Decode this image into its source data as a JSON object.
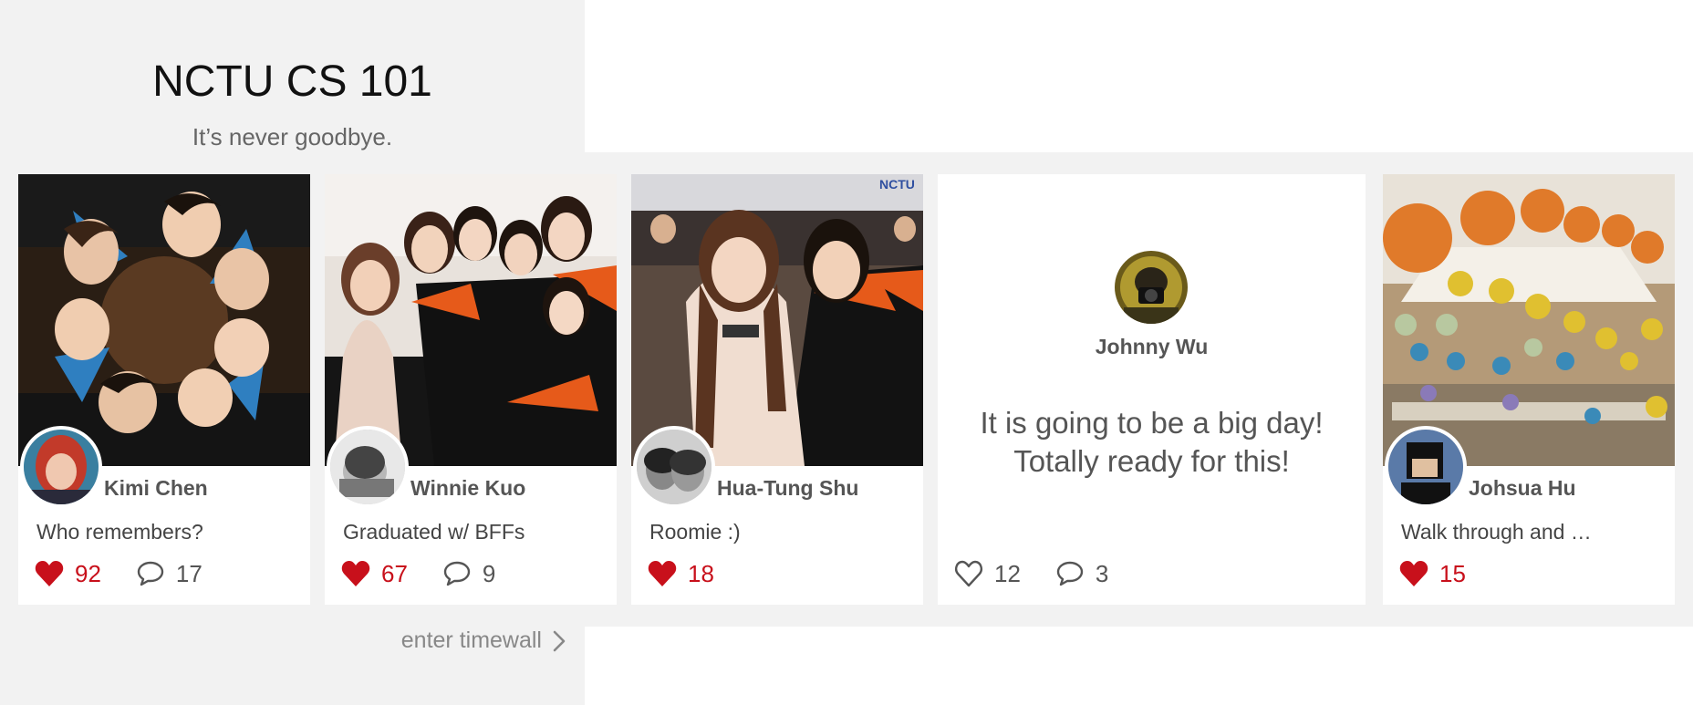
{
  "header": {
    "title": "NCTU CS 101",
    "subtitle": "It’s never goodbye."
  },
  "cards": [
    {
      "author": "Kimi Chen",
      "caption": "Who remembers?",
      "likes": "92",
      "comments": "17",
      "liked": true
    },
    {
      "author": "Winnie Kuo",
      "caption": "Graduated w/ BFFs",
      "likes": "67",
      "comments": "9",
      "liked": true
    },
    {
      "author": "Hua-Tung Shu",
      "caption": "Roomie :)",
      "likes": "18",
      "liked": true
    },
    {
      "author": "Johnny Wu",
      "text": "It is going to be a big day! Totally ready for this!",
      "likes": "12",
      "comments": "3",
      "liked": false
    },
    {
      "author": "Johsua Hu",
      "caption": "Walk through and …",
      "likes": "15",
      "liked": true
    }
  ],
  "footer": {
    "enter_link": "enter timewall"
  },
  "icons": {
    "heart": "heart-icon",
    "comment": "comment-icon",
    "chevron": "chevron-right-icon"
  },
  "colors": {
    "like_red": "#c8101b",
    "panel_bg": "#f2f2f2"
  }
}
